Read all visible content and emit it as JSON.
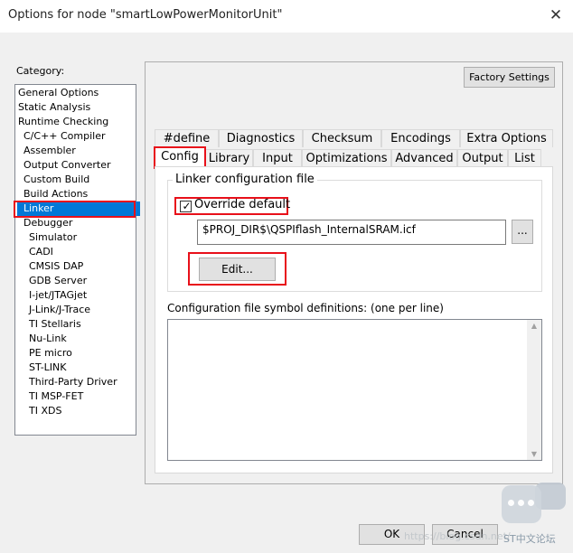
{
  "window": {
    "title": "Options for node \"smartLowPowerMonitorUnit\"",
    "close_glyph": "✕"
  },
  "category": {
    "label": "Category:",
    "items": [
      "General Options",
      "Static Analysis",
      "Runtime Checking",
      "C/C++ Compiler",
      "Assembler",
      "Output Converter",
      "Custom Build",
      "Build Actions",
      "Linker",
      "Debugger",
      "Simulator",
      "CADI",
      "CMSIS DAP",
      "GDB Server",
      "I-jet/JTAGjet",
      "J-Link/J-Trace",
      "TI Stellaris",
      "Nu-Link",
      "PE micro",
      "ST-LINK",
      "Third-Party Driver",
      "TI MSP-FET",
      "TI XDS"
    ],
    "selected": "Linker"
  },
  "buttons": {
    "factory": "Factory Settings",
    "browse": "...",
    "edit": "Edit...",
    "ok": "OK",
    "cancel": "Cancel"
  },
  "tabs": {
    "row1": [
      "#define",
      "Diagnostics",
      "Checksum",
      "Encodings",
      "Extra Options"
    ],
    "row2": [
      "Config",
      "Library",
      "Input",
      "Optimizations",
      "Advanced",
      "Output",
      "List"
    ],
    "active": "Config"
  },
  "config": {
    "group_label": "Linker configuration file",
    "override_label": "Override default",
    "override_checked": true,
    "check_glyph": "✓",
    "path_value": "$PROJ_DIR$\\QSPIflash_InternalSRAM.icf",
    "defs_label": "Configuration file symbol definitions: (one per line)",
    "defs_value": ""
  },
  "scrollbar": {
    "up": "▲",
    "down": "▼"
  },
  "watermark": {
    "text": "ST中文论坛",
    "url": "https://blog.csdn.net/"
  },
  "colors": {
    "highlight_box": "#e8101a",
    "selection": "#0078d7"
  }
}
